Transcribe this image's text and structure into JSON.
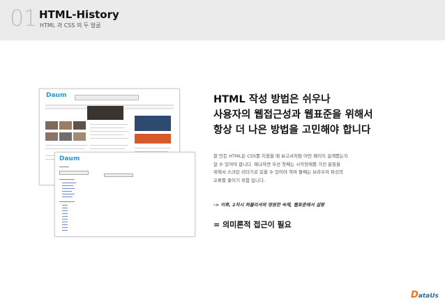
{
  "header": {
    "number": "01",
    "title": "HTML-History",
    "subtitle": "HTML 과 CSS 의 두 얼굴"
  },
  "screenshots": {
    "logo_1": "Daum",
    "logo_2": "Daum"
  },
  "main": {
    "heading_lines": [
      "HTML 작성 방법은 쉬우나",
      "사용자의 웹접근성과 웹표준을 위해서",
      "항상 더 나은 방법을 고민해야 합니다"
    ],
    "description_lines": [
      "잘 만든 HTML은 CSS를 지웠을 때 보고서처럼 어떤 페이지 설계했는지",
      "알 수 있어야 합니다. 왜냐하면 우선 첫째는 시각장애를 가진 분들을",
      "위해서 스크린 리더기로 읽을 수 있어야 하며 둘째는 브라우저 파싱의",
      "오류를 줄이기 위함 입니다."
    ],
    "note": "-> 이후, 2차시 퍼블리셔의 영원한 숙제, 웹표준에서 설명",
    "conclusion": "= 의미론적 접근이 필요"
  },
  "brand": {
    "mark": "D",
    "name": "ataUs"
  },
  "colors": {
    "header_bg": "#ebebeb",
    "accent_orange": "#e8741f",
    "accent_blue": "#2d68a8"
  }
}
